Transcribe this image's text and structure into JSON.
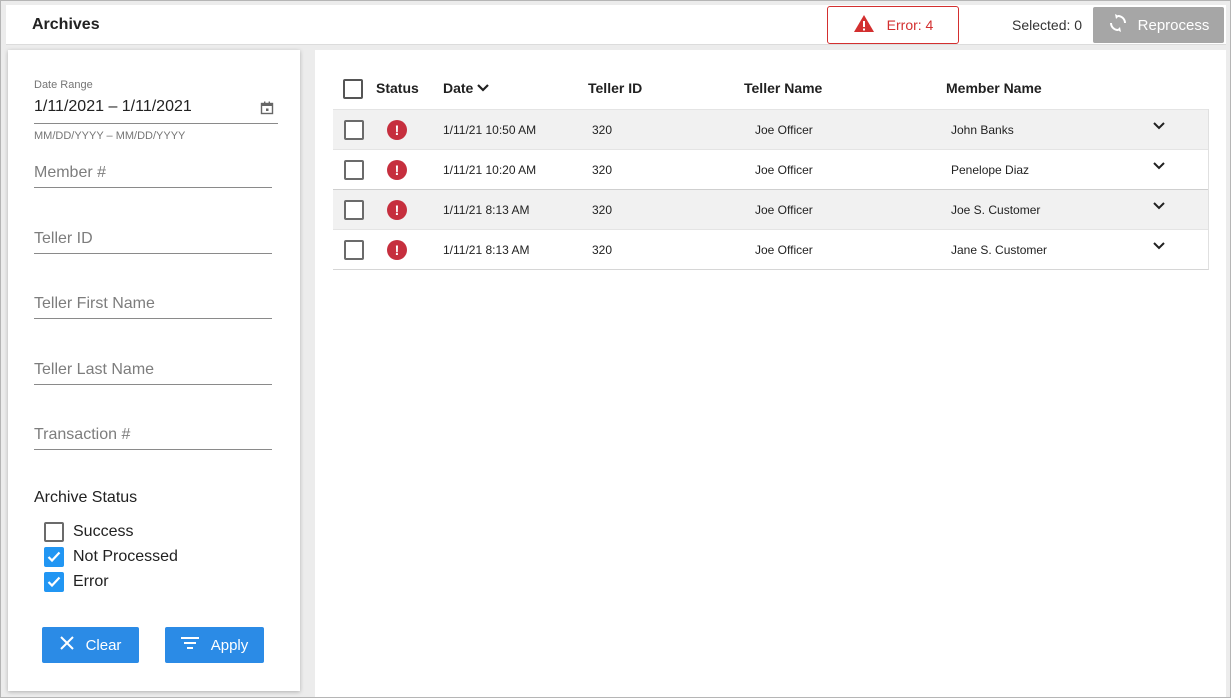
{
  "header": {
    "title": "Archives",
    "error_label": "Error: 4",
    "selected_label": "Selected: 0",
    "reprocess_label": "Reprocess"
  },
  "filters": {
    "date_range_label": "Date Range",
    "date_range_value": "1/11/2021 – 1/11/2021",
    "date_range_hint": "MM/DD/YYYY – MM/DD/YYYY",
    "member_placeholder": "Member #",
    "teller_id_placeholder": "Teller ID",
    "teller_first_placeholder": "Teller First Name",
    "teller_last_placeholder": "Teller Last Name",
    "transaction_placeholder": "Transaction #",
    "archive_status_title": "Archive Status",
    "statuses": [
      {
        "label": "Success",
        "checked": false
      },
      {
        "label": "Not Processed",
        "checked": true
      },
      {
        "label": "Error",
        "checked": true
      }
    ],
    "clear_label": "Clear",
    "apply_label": "Apply"
  },
  "table": {
    "columns": {
      "status": "Status",
      "date": "Date",
      "teller_id": "Teller ID",
      "teller_name": "Teller Name",
      "member_name": "Member Name"
    },
    "rows": [
      {
        "date": "1/11/21 10:50 AM",
        "teller_id": "320",
        "teller_name": "Joe Officer",
        "member_name": "John Banks"
      },
      {
        "date": "1/11/21 10:20 AM",
        "teller_id": "320",
        "teller_name": "Joe Officer",
        "member_name": "Penelope Diaz"
      },
      {
        "date": "1/11/21 8:13 AM",
        "teller_id": "320",
        "teller_name": "Joe Officer",
        "member_name": "Joe S. Customer"
      },
      {
        "date": "1/11/21 8:13 AM",
        "teller_id": "320",
        "teller_name": "Joe Officer",
        "member_name": "Jane S. Customer"
      }
    ]
  },
  "colors": {
    "accent_blue": "#2b8be6",
    "error_red": "#d32f2f",
    "disabled_gray": "#a6a6a6"
  }
}
